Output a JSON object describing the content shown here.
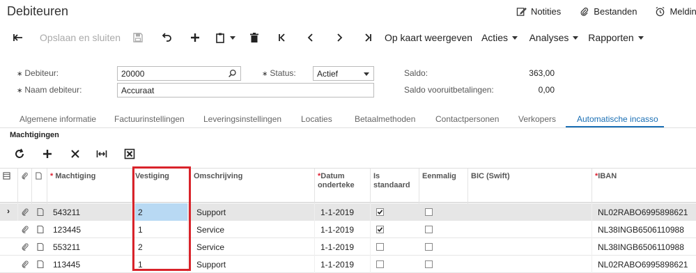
{
  "header": {
    "title": "Debiteuren",
    "links": [
      {
        "label": "Notities",
        "icon": "edit-note-icon"
      },
      {
        "label": "Bestanden",
        "icon": "paperclip-icon"
      },
      {
        "label": "Melding",
        "icon": "alarm-clock-icon"
      }
    ]
  },
  "toolbar": {
    "save_close_label": "Opslaan en sluiten",
    "map_label": "Op kaart weergeven",
    "actions_label": "Acties",
    "analyses_label": "Analyses",
    "reports_label": "Rapporten"
  },
  "form": {
    "debiteur_label": "Debiteur:",
    "debiteur_value": "20000",
    "naam_label": "Naam debiteur:",
    "naam_value": "Accuraat",
    "status_label": "Status:",
    "status_value": "Actief",
    "saldo_label": "Saldo:",
    "saldo_value": "363,00",
    "saldo_voor_label": "Saldo vooruitbetalingen:",
    "saldo_voor_value": "0,00"
  },
  "tabs": [
    {
      "label": "Algemene informatie"
    },
    {
      "label": "Factuurinstellingen"
    },
    {
      "label": "Leveringsinstellingen"
    },
    {
      "label": "Locaties"
    },
    {
      "label": "Betaalmethoden"
    },
    {
      "label": "Contactpersonen"
    },
    {
      "label": "Verkopers"
    },
    {
      "label": "Automatische incasso"
    }
  ],
  "active_tab": "Automatische incasso",
  "section": {
    "title": "Machtigingen"
  },
  "grid": {
    "columns": {
      "machtiging": "Machtiging",
      "vestiging": "Vestiging",
      "omschrijving": "Omschrijving",
      "datum": "Datum onderteke",
      "standaard": "Is standaard",
      "eenmalig": "Eenmalig",
      "bic": "BIC (Swift)",
      "iban": "IBAN"
    },
    "rows": [
      {
        "machtiging": "543211",
        "vestiging": "2",
        "omschrijving": "Support",
        "datum": "1-1-2019",
        "standaard": true,
        "eenmalig": false,
        "bic": "",
        "iban": "NL02RABO6995898621"
      },
      {
        "machtiging": "123445",
        "vestiging": "1",
        "omschrijving": "Service",
        "datum": "1-1-2019",
        "standaard": true,
        "eenmalig": false,
        "bic": "",
        "iban": "NL38INGB6506110988"
      },
      {
        "machtiging": "553211",
        "vestiging": "2",
        "omschrijving": "Service",
        "datum": "1-1-2019",
        "standaard": false,
        "eenmalig": false,
        "bic": "",
        "iban": "NL38INGB6506110988"
      },
      {
        "machtiging": "113445",
        "vestiging": "1",
        "omschrijving": "Support",
        "datum": "1-1-2019",
        "standaard": false,
        "eenmalig": false,
        "bic": "",
        "iban": "NL02RABO6995898621"
      }
    ]
  },
  "colors": {
    "accent": "#1a6fb4",
    "highlight_box": "#d9232a",
    "selected_cell": "#b8d9f3"
  }
}
